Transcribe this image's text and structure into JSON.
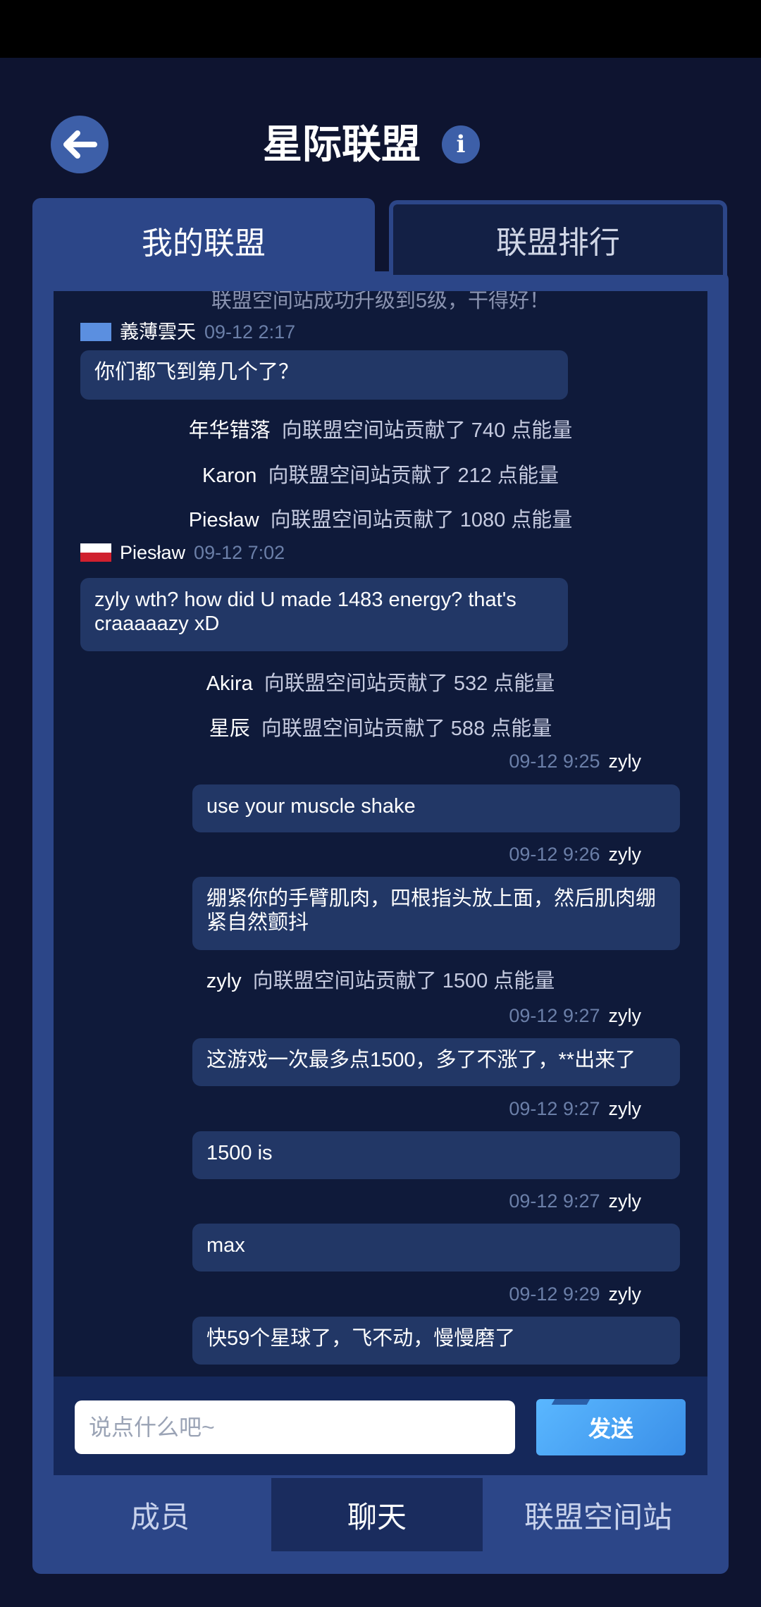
{
  "header": {
    "title": "星际联盟"
  },
  "tabs": {
    "my_alliance": "我的联盟",
    "ranking": "联盟排行"
  },
  "chat": {
    "truncated_top": "联盟空间站成功升级到5级，干得好！",
    "messages": [
      {
        "kind": "user",
        "name": "義薄雲天",
        "time": "09-12 2:17",
        "flag": "un",
        "text": "你们都飞到第几个了？"
      },
      {
        "kind": "system",
        "name": "年华错落",
        "text": "向联盟空间站贡献了 740 点能量"
      },
      {
        "kind": "system",
        "name": "Karon",
        "text": "向联盟空间站贡献了 212 点能量"
      },
      {
        "kind": "system",
        "name": "Piesław",
        "text": "向联盟空间站贡献了 1080 点能量"
      },
      {
        "kind": "user",
        "name": "Piesław",
        "time": "09-12 7:02",
        "flag": "pl",
        "text": "zyly wth? how did U made 1483 energy? that's craaaaazy xD"
      },
      {
        "kind": "system",
        "name": "Akira",
        "text": "向联盟空间站贡献了 532 点能量"
      },
      {
        "kind": "system",
        "name": "星辰",
        "text": "向联盟空间站贡献了 588 点能量"
      },
      {
        "kind": "self",
        "name": "zyly",
        "time": "09-12 9:25",
        "text": "use your muscle shake"
      },
      {
        "kind": "self",
        "name": "zyly",
        "time": "09-12 9:26",
        "text": "绷紧你的手臂肌肉，四根指头放上面，然后肌肉绷紧自然颤抖"
      },
      {
        "kind": "system",
        "name": "zyly",
        "text": "向联盟空间站贡献了 1500 点能量"
      },
      {
        "kind": "self",
        "name": "zyly",
        "time": "09-12 9:27",
        "text": "这游戏一次最多点1500，多了不涨了，**出来了"
      },
      {
        "kind": "self",
        "name": "zyly",
        "time": "09-12 9:27",
        "text": "1500 is"
      },
      {
        "kind": "self",
        "name": "zyly",
        "time": "09-12 9:27",
        "text": "max"
      },
      {
        "kind": "self",
        "name": "zyly",
        "time": "09-12 9:29",
        "text": "快59个星球了，飞不动，慢慢磨了"
      }
    ]
  },
  "input": {
    "placeholder": "说点什么吧~",
    "send_label": "发送"
  },
  "bottom_tabs": {
    "members": "成员",
    "chat": "聊天",
    "station": "联盟空间站"
  },
  "colors": {
    "background": "#0e1430",
    "panel": "#2c4688",
    "bubble": "#223766",
    "send": "#4aa6f8"
  }
}
